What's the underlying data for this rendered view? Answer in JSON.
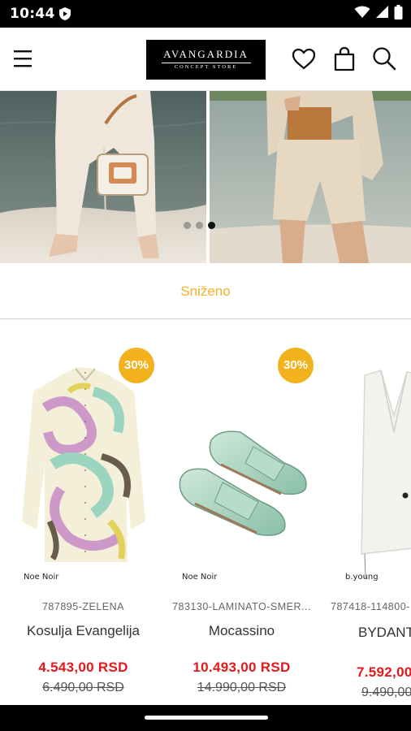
{
  "status_bar": {
    "time": "10:44",
    "icons": [
      "shield-app-icon",
      "wifi-icon",
      "signal-icon",
      "battery-icon"
    ]
  },
  "header": {
    "logo_title": "AVANGARDIA",
    "logo_subtitle": "CONCEPT STORE",
    "icons": [
      "menu-icon",
      "heart-icon",
      "shopping-bag-icon",
      "search-icon"
    ]
  },
  "banner": {
    "slide_count": 3,
    "active_slide": 3
  },
  "section": {
    "label": "Sniženo"
  },
  "colors": {
    "accent": "#f4b328",
    "badge": "#f2b21e",
    "price": "#e4171c"
  },
  "products": [
    {
      "discount": "30%",
      "brand": "Noe Noir",
      "sku": "787895-ZELENA",
      "name": "Kosulja Evangelija",
      "price": "4.543,00 RSD",
      "old_price": "6.490,00 RSD"
    },
    {
      "discount": "30%",
      "brand": "Noe Noir",
      "sku": "783130-LAMINATO-SMER...",
      "name": "Mocassino",
      "price": "10.493,00 RSD",
      "old_price": "14.990,00 RSD"
    },
    {
      "brand": "b.young",
      "sku": "787418-114800-",
      "name": "BYDANT WAISTO",
      "price": "7.592,00",
      "old_price": "9.490,00"
    }
  ]
}
